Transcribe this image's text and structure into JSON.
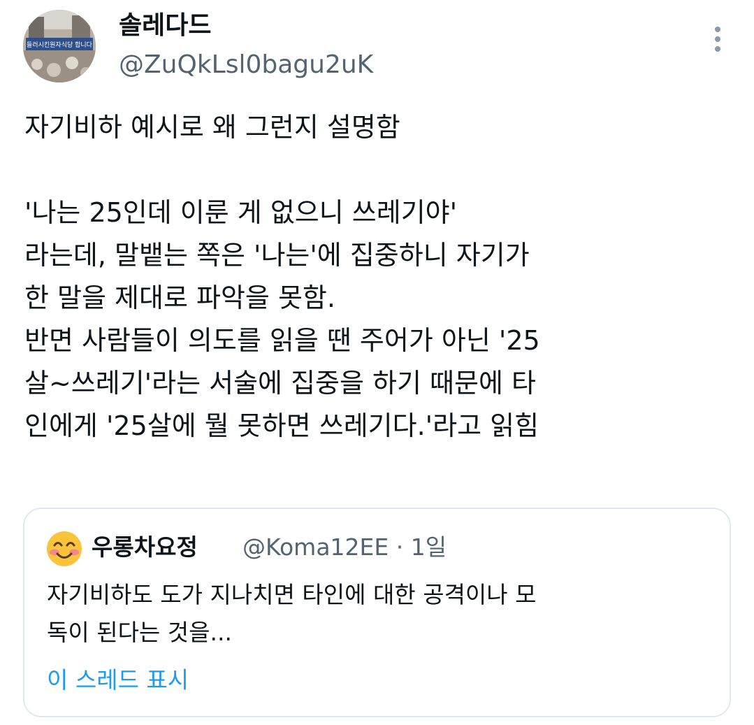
{
  "author": {
    "display_name": "솔레다드",
    "handle": "@ZuQkLsl0bagu2uK",
    "avatar_icon": "avatar-photo-icon",
    "avatar_banner_text": "들러시킨원자식당 합니다"
  },
  "tweet": {
    "lines": [
      "자기비하 예시로 왜 그런지 설명함",
      "",
      "'나는 25인데 이룬 게 없으니 쓰레기야'",
      "라는데, 말뱉는 쪽은 '나는'에 집중하니 자기가",
      "한 말을 제대로 파악을 못함.",
      "반면 사람들이 의도를 읽을 땐 주어가 아닌 '25",
      "살~쓰레기'라는 서술에 집중을 하기 때문에 타",
      "인에게 '25살에 뭘 못하면 쓰레기다.'라고 읽힘"
    ]
  },
  "quote": {
    "display_name": "우롱차요정",
    "meta": "@Koma12EE · 1일",
    "lines": [
      "자기비하도 도가 지나치면 타인에 대한 공격이나 모",
      "독이 된다는 것을..."
    ],
    "show_thread": "이 스레드 표시"
  },
  "icons": {
    "more": "more-options-icon",
    "quote_avatar": "smiling-face-emoji-icon"
  },
  "colors": {
    "text": "#0f1419",
    "secondary": "#536471",
    "link": "#1d9bf0",
    "border": "#e1e8ed"
  }
}
